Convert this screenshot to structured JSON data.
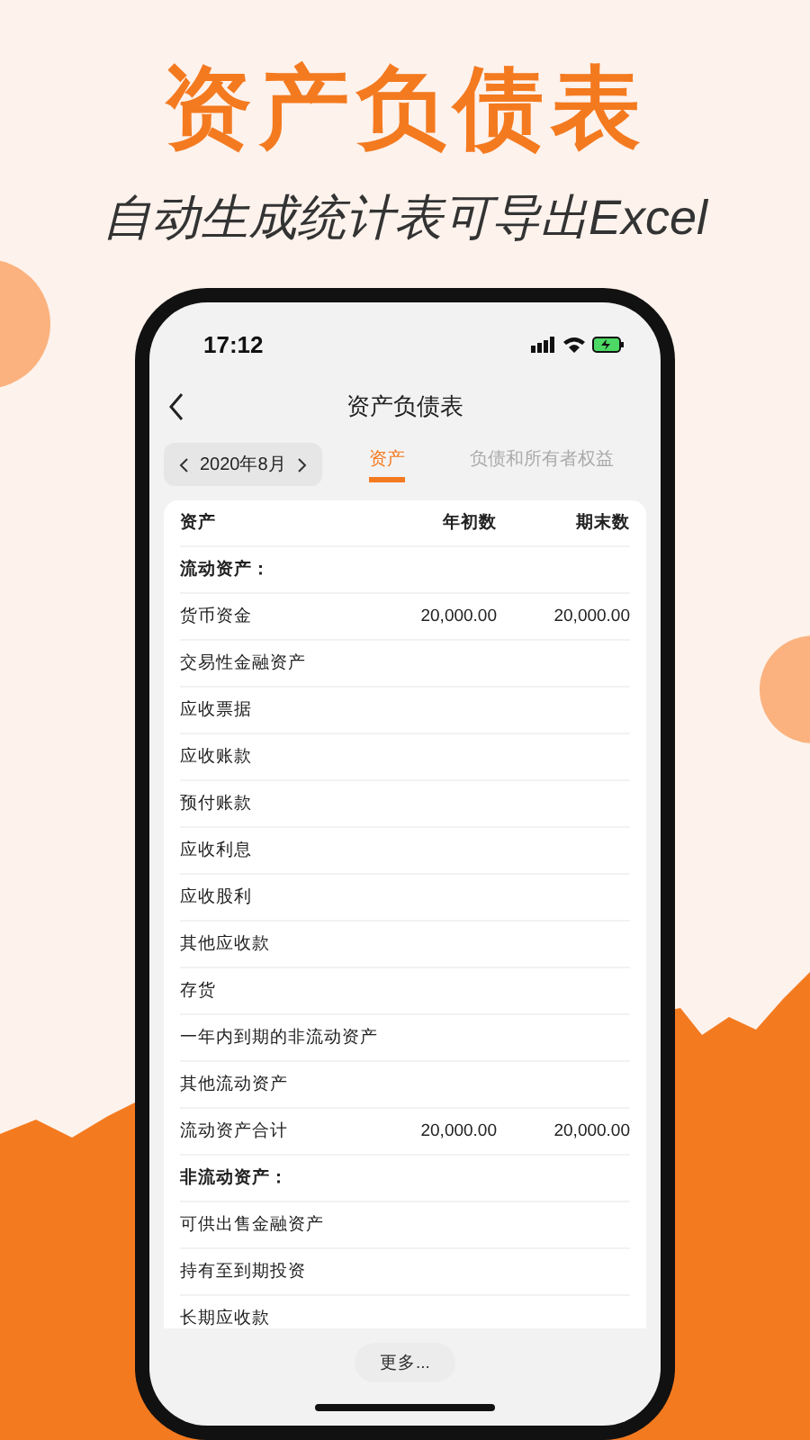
{
  "headline": "资产负债表",
  "subtitle": "自动生成统计表可导出Excel",
  "status_bar": {
    "time": "17:12"
  },
  "nav": {
    "title": "资产负债表"
  },
  "period": {
    "label": "2020年8月"
  },
  "tabs": [
    {
      "label": "资产",
      "selected": true
    },
    {
      "label": "负债和所有者权益",
      "selected": false
    }
  ],
  "table": {
    "columns": [
      "资产",
      "年初数",
      "期末数"
    ],
    "rows": [
      {
        "kind": "section",
        "label": "流动资产："
      },
      {
        "kind": "item",
        "label": "货币资金",
        "start": "20,000.00",
        "end": "20,000.00"
      },
      {
        "kind": "item",
        "label": "交易性金融资产"
      },
      {
        "kind": "item",
        "label": "应收票据"
      },
      {
        "kind": "item",
        "label": "应收账款"
      },
      {
        "kind": "item",
        "label": "预付账款"
      },
      {
        "kind": "item",
        "label": "应收利息"
      },
      {
        "kind": "item",
        "label": "应收股利"
      },
      {
        "kind": "item",
        "label": "其他应收款"
      },
      {
        "kind": "item",
        "label": "存货"
      },
      {
        "kind": "item",
        "label": "一年内到期的非流动资产"
      },
      {
        "kind": "item",
        "label": "其他流动资产"
      },
      {
        "kind": "item",
        "label": "流动资产合计",
        "start": "20,000.00",
        "end": "20,000.00"
      },
      {
        "kind": "section",
        "label": "非流动资产："
      },
      {
        "kind": "item",
        "label": "可供出售金融资产"
      },
      {
        "kind": "item",
        "label": "持有至到期投资"
      },
      {
        "kind": "item",
        "label": "长期应收款"
      }
    ]
  },
  "more_button": "更多..."
}
